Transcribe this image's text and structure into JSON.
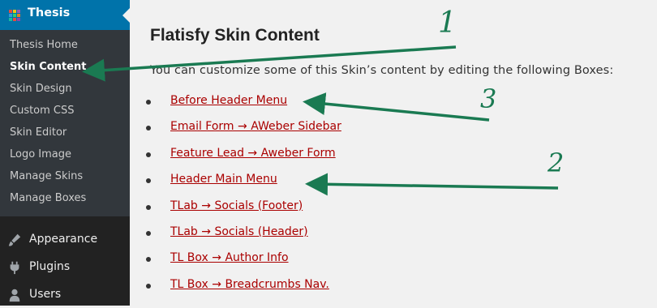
{
  "sidebar": {
    "active_menu": {
      "label": "Thesis",
      "icon": "thesis-grid-icon"
    },
    "submenu": [
      {
        "label": "Thesis Home",
        "current": false
      },
      {
        "label": "Skin Content",
        "current": true
      },
      {
        "label": "Skin Design",
        "current": false
      },
      {
        "label": "Custom CSS",
        "current": false
      },
      {
        "label": "Skin Editor",
        "current": false
      },
      {
        "label": "Logo Image",
        "current": false
      },
      {
        "label": "Manage Skins",
        "current": false
      },
      {
        "label": "Manage Boxes",
        "current": false
      }
    ],
    "menu": [
      {
        "label": "Appearance",
        "icon": "paintbrush-icon"
      },
      {
        "label": "Plugins",
        "icon": "plug-icon"
      },
      {
        "label": "Users",
        "icon": "user-icon"
      }
    ]
  },
  "content": {
    "title": "Flatisfy Skin Content",
    "intro": "You can customize some of this Skin’s content by editing the following Boxes:",
    "boxes": [
      "Before Header Menu",
      "Email Form → AWeber Sidebar",
      "Feature Lead → Aweber Form",
      "Header Main Menu",
      "TLab → Socials (Footer)",
      "TLab → Socials (Header)",
      "TL Box → Author Info",
      "TL Box → Breadcrumbs Nav."
    ]
  },
  "annotations": {
    "labels": [
      "1",
      "2",
      "3"
    ],
    "color": "#1a7a52"
  },
  "colors": {
    "sidebar_bg": "#222222",
    "submenu_bg": "#32373c",
    "active_bg": "#0073aa",
    "link": "#aa0000"
  }
}
